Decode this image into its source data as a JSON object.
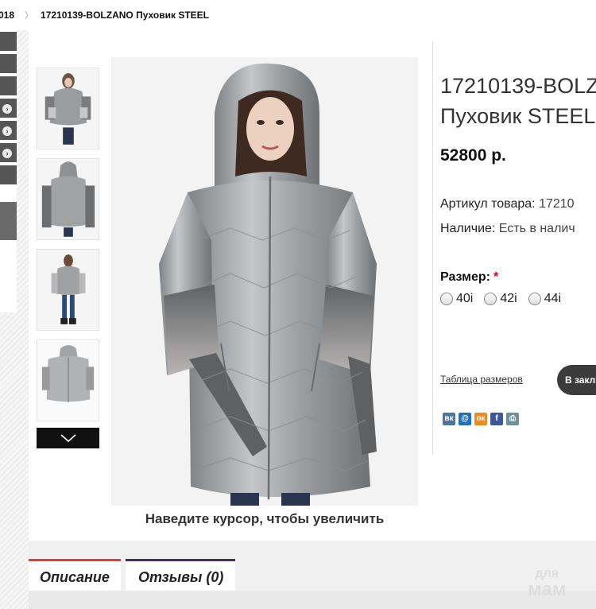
{
  "breadcrumb": {
    "prev": "018",
    "separator": "〉",
    "current": "17210139-BOLZANO Пуховик STEEL"
  },
  "gallery": {
    "thumbnails": [
      "front-view",
      "back-view",
      "full-length",
      "flat-view"
    ],
    "next_icon": "chevron-down-icon",
    "zoom_hint": "Наведите курсор, чтобы увеличить"
  },
  "product": {
    "title_line1": "17210139-BOLZ",
    "title_line2": "Пуховик STEEL",
    "price": "52800 р.",
    "article_label": "Артикул товара:",
    "article_value": "17210",
    "availability_label": "Наличие:",
    "availability_value": "Есть в налич",
    "size_label": "Размер:",
    "required_mark": "*",
    "sizes": [
      "40i",
      "42i",
      "44i"
    ],
    "size_table_link": "Таблица размеров",
    "cart_button": "В закл"
  },
  "social": [
    {
      "name": "vk-icon",
      "glyph": "вк",
      "color": "#4c75a3"
    },
    {
      "name": "mail-icon",
      "glyph": "@",
      "color": "#1e6fc2"
    },
    {
      "name": "ok-icon",
      "glyph": "ок",
      "color": "#f2891f"
    },
    {
      "name": "facebook-icon",
      "glyph": "f",
      "color": "#3b5998"
    },
    {
      "name": "print-icon",
      "glyph": "⎙",
      "color": "#6f8f99"
    }
  ],
  "tabs": {
    "description": "Описание",
    "reviews": "Отзывы (0)"
  },
  "watermark": {
    "line1": "для",
    "line2": "мам"
  }
}
